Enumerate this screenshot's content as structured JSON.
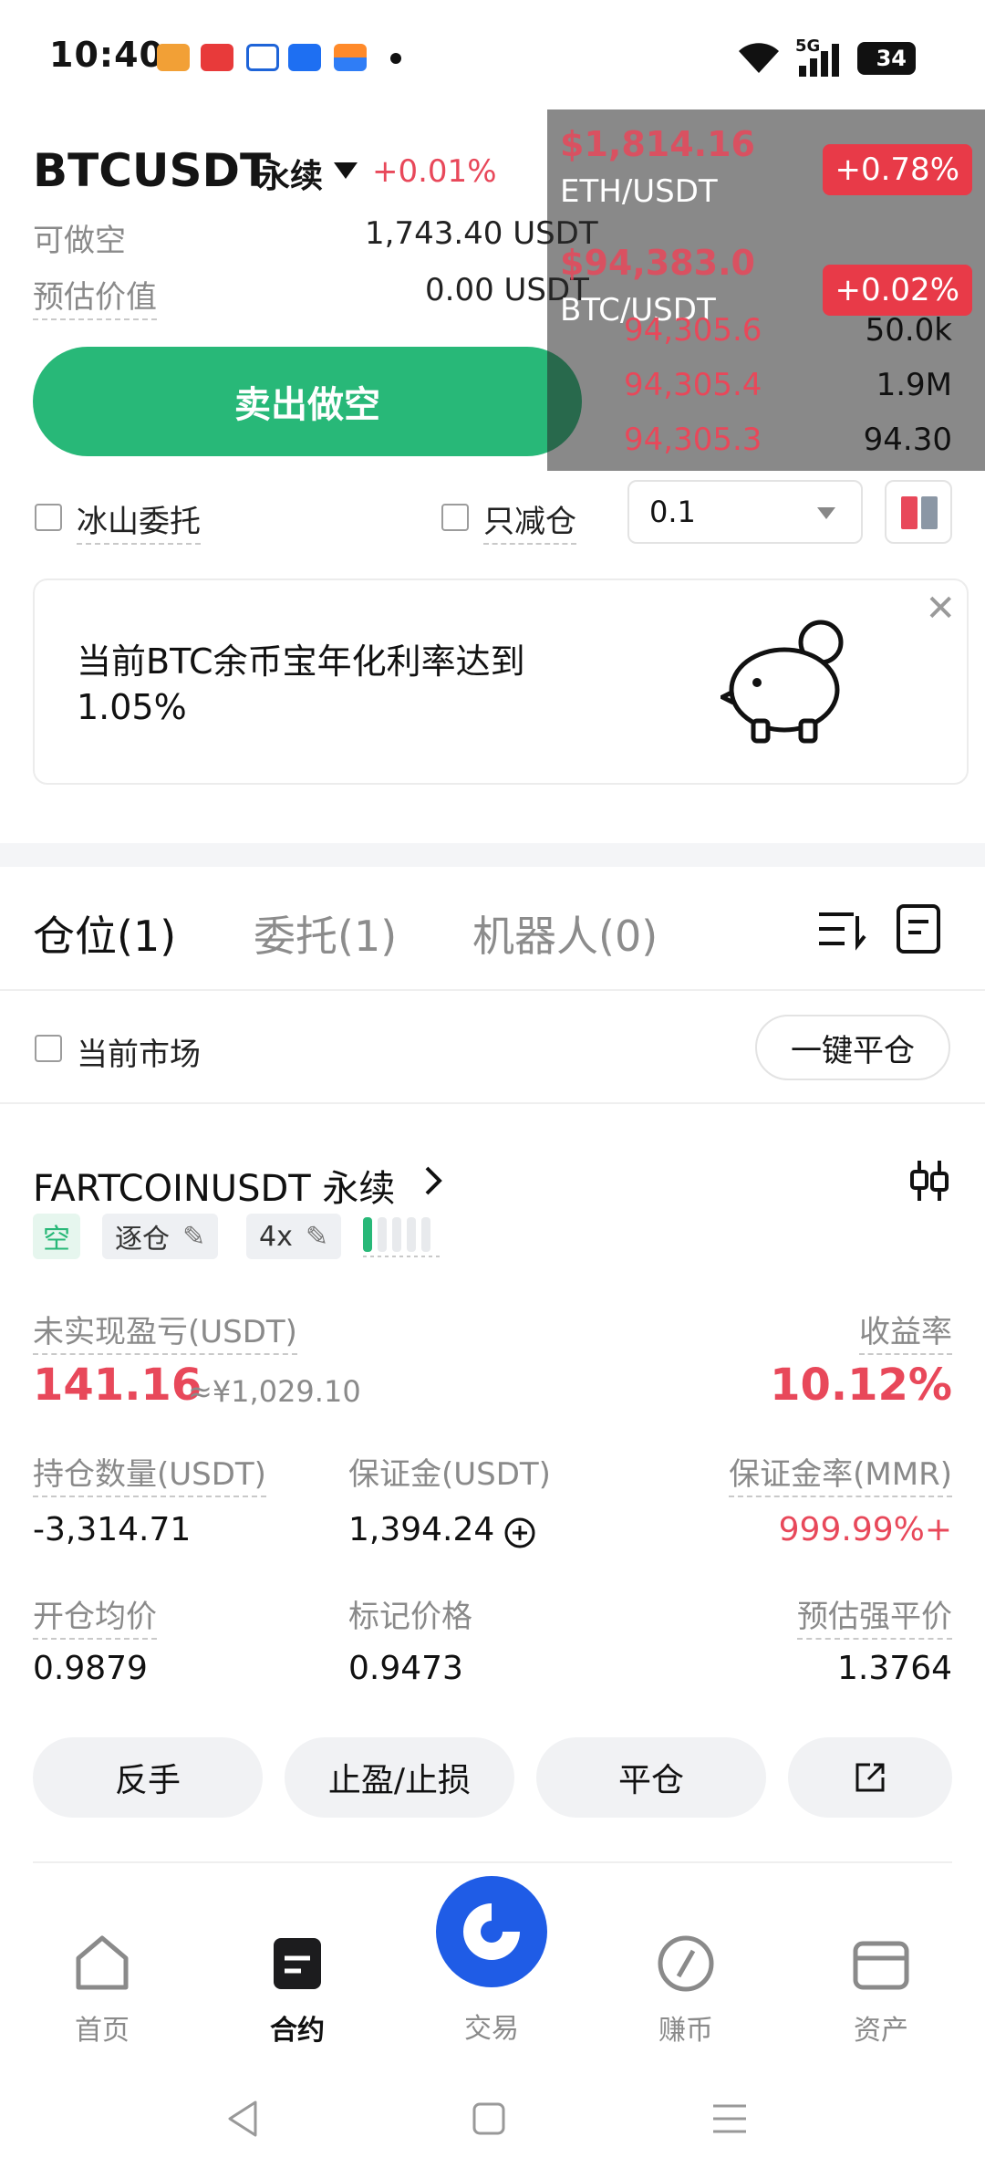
{
  "status_bar": {
    "time": "10:40",
    "battery": "34",
    "network": "5G"
  },
  "header": {
    "symbol": "BTCUSDT",
    "contract": "永续",
    "change": "+0.01%"
  },
  "order_form": {
    "available_short_label": "可做空",
    "available_short_value": "1,743.40 USDT",
    "est_value_label": "预估价值",
    "est_value": "0.00 USDT",
    "sell_button": "卖出做空",
    "iceberg_label": "冰山委托",
    "reduce_only_label": "只减仓",
    "qty_value": "0.1"
  },
  "overlay": {
    "eth_price": "$1,814.16",
    "eth_symbol": "ETH/USDT",
    "eth_change": "+0.78%",
    "btc_price": "$94,383.0",
    "btc_symbol": "BTC/USDT",
    "btc_change": "+0.02%",
    "orderbook": [
      {
        "price": "94,305.6",
        "qty": "50.0k"
      },
      {
        "price": "94,305.4",
        "qty": "1.9M"
      },
      {
        "price": "94,305.3",
        "qty": "94.30"
      }
    ]
  },
  "promo": {
    "text": "当前BTC余币宝年化利率达到1.05%"
  },
  "tabs": [
    {
      "label": "仓位(1)"
    },
    {
      "label": "委托(1)"
    },
    {
      "label": "机器人(0)"
    }
  ],
  "filter": {
    "current_market_label": "当前市场",
    "close_all_label": "一键平仓"
  },
  "position": {
    "title": "FARTCOINUSDT 永续",
    "side_tag": "空",
    "margin_mode": "逐仓",
    "leverage": "4x",
    "pnl_label": "未实现盈亏(USDT)",
    "pnl_value": "141.16",
    "pnl_cny": "≈¥1,029.10",
    "roi_label": "收益率",
    "roi_value": "10.12%",
    "size_label": "持仓数量(USDT)",
    "size_value": "-3,314.71",
    "margin_label": "保证金(USDT)",
    "margin_value": "1,394.24",
    "mmr_label": "保证金率(MMR)",
    "mmr_value": "999.99%+",
    "entry_label": "开仓均价",
    "entry_value": "0.9879",
    "mark_label": "标记价格",
    "mark_value": "0.9473",
    "liq_label": "预估强平价",
    "liq_value": "1.3764",
    "actions": [
      "反手",
      "止盈/止损",
      "平仓"
    ]
  },
  "bottom_nav": [
    {
      "label": "首页",
      "icon": "home-icon"
    },
    {
      "label": "合约",
      "icon": "contract-icon"
    },
    {
      "label": "交易",
      "icon": "trade-icon"
    },
    {
      "label": "赚币",
      "icon": "earn-icon"
    },
    {
      "label": "资产",
      "icon": "wallet-icon"
    }
  ],
  "colors": {
    "green": "#28b878",
    "red": "#e8485a",
    "blue": "#1f5ce6"
  }
}
